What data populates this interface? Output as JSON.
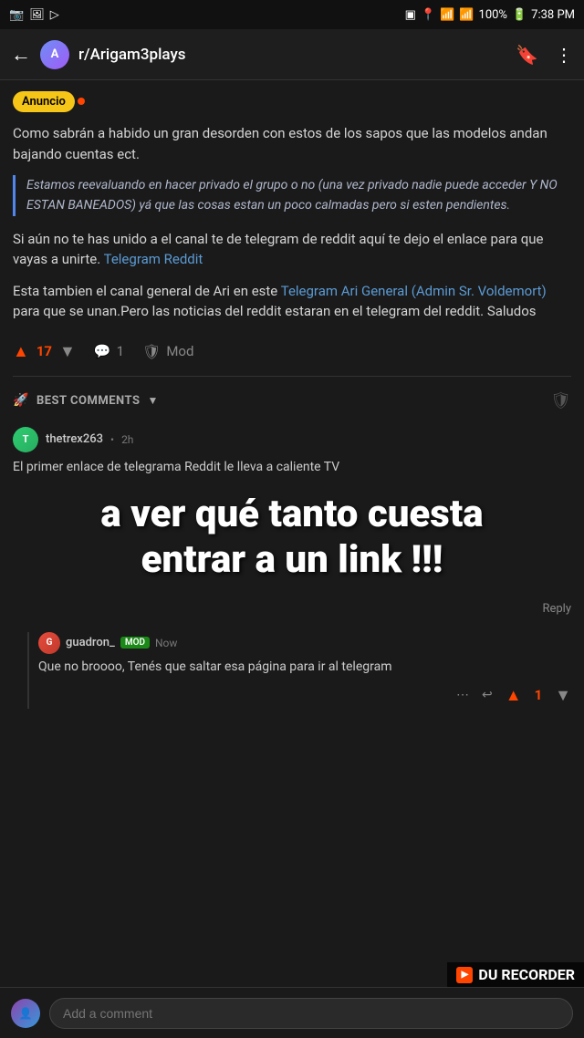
{
  "statusBar": {
    "time": "7:38 PM",
    "battery": "100%",
    "signal": "▌▌▌▌",
    "wifi": "WiFi"
  },
  "nav": {
    "back": "←",
    "subreddit": "r/Arigam3plays",
    "bookmark": "🔖",
    "more": "⋮"
  },
  "post": {
    "badge": "Anuncio",
    "bodyText1": "Como sabrán a habido un gran desorden con estos de los sapos que las modelos andan bajando cuentas ect.",
    "blockquote": "Estamos reevaluando en hacer privado el grupo o no (una vez privado nadie puede acceder Y NO ESTAN BANEADOS) yá que las cosas estan un poco calmadas pero si esten pendientes.",
    "bodyText2": "Si aún no te has unido a el canal te de telegram de reddit aquí te dejo el enlace para que vayas a unirte.",
    "telegramLink1": "Telegram Reddit",
    "bodyText3": "Esta tambien el canal general de Ari en este",
    "telegramLink2": "Telegram Ari General (Admin Sr. Voldemort)",
    "bodyText4": "para que se unan.Pero las noticias del reddit estaran en el telegram del reddit. Saludos",
    "upvotes": "17",
    "comments": "1",
    "modLabel": "Mod"
  },
  "commentsBar": {
    "label": "BEST COMMENTS",
    "rocketIcon": "🚀",
    "chevron": "▼"
  },
  "comment1": {
    "user": "thetrex263",
    "time": "2h",
    "text": "El primer enlace de telegrama Reddit le lleva a caliente TV",
    "overlayLine1": "a ver qué tanto cuesta",
    "overlayLine2": "entrar a un link !!!",
    "replyLabel": "Reply"
  },
  "reply1": {
    "user": "guadron_",
    "modTag": "MOD",
    "time": "Now",
    "text": "Que no broooo, Tenés que saltar esa página para ir al telegram",
    "upvotes": "1"
  },
  "bottomBar": {
    "placeholder": "Add a comment"
  },
  "watermark": "DU RECORDER"
}
